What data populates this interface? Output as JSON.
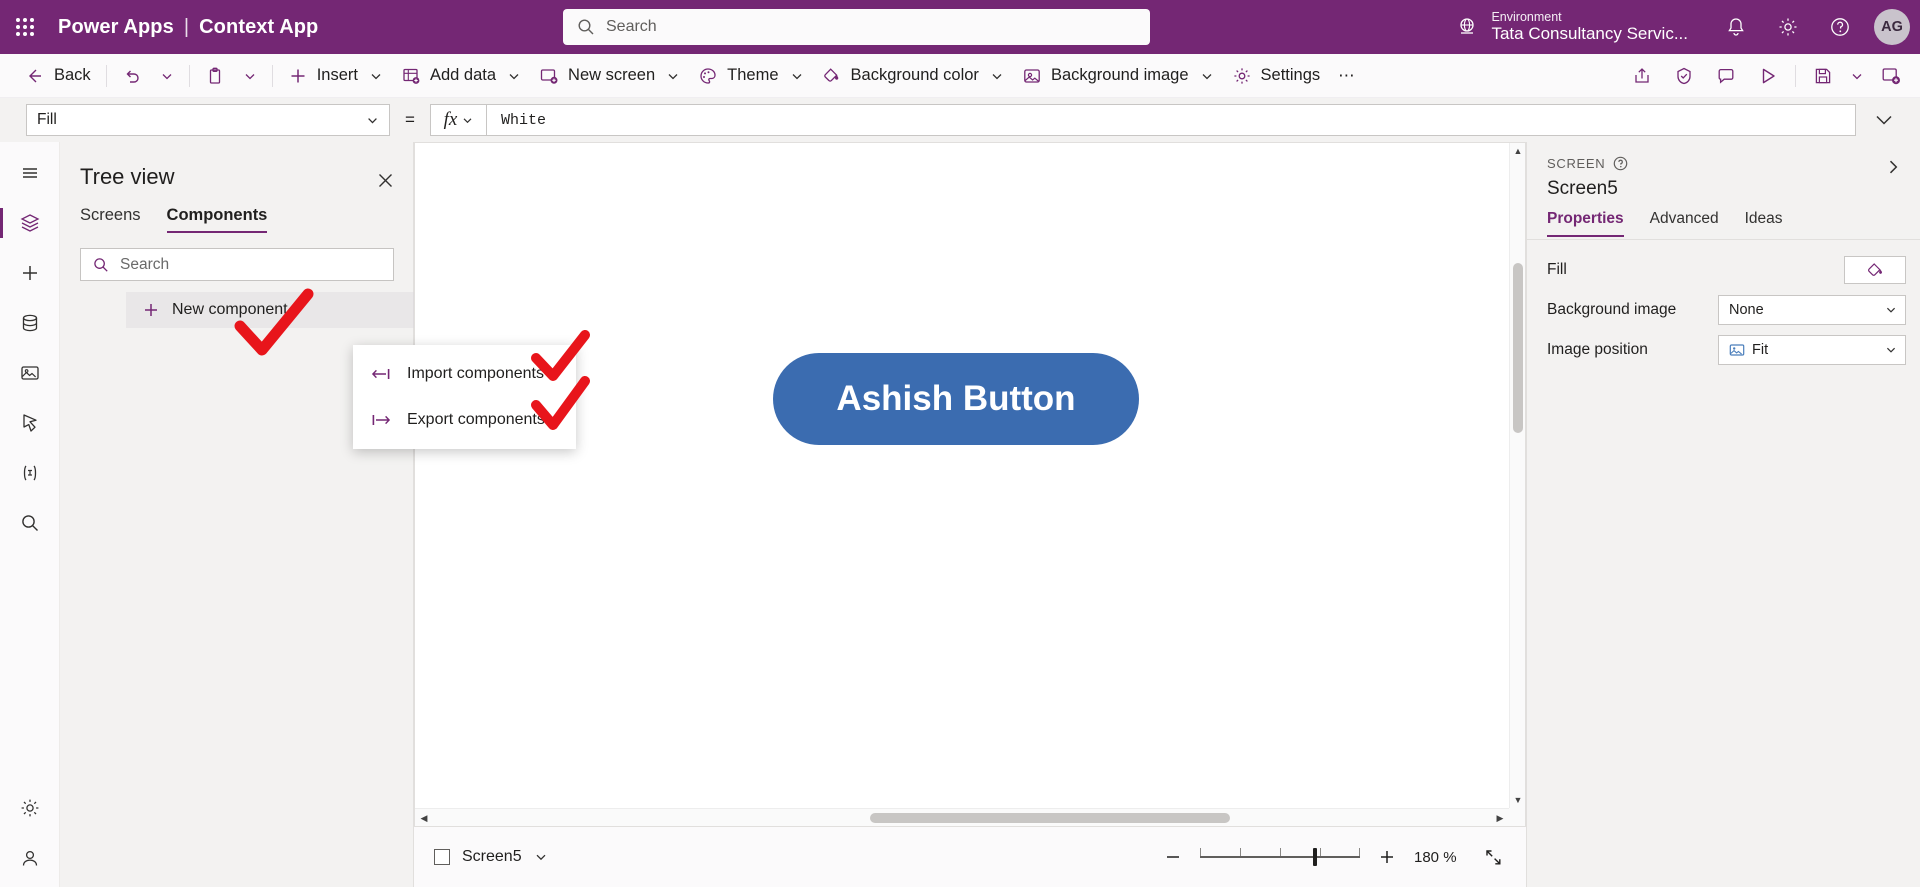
{
  "header": {
    "waffle_icon": "waffle-icon",
    "brand": "Power Apps",
    "separator": "|",
    "context_app": "Context App",
    "search_placeholder": "Search",
    "search_icon": "search-icon",
    "environment_label": "Environment",
    "environment_name": "Tata Consultancy Servic...",
    "environment_icon": "globe-icon",
    "notification_icon": "bell-icon",
    "settings_icon": "gear-icon",
    "help_icon": "help-icon",
    "avatar_initials": "AG",
    "accent_purple": "#742774"
  },
  "commandbar": {
    "back": "Back",
    "back_icon": "arrow-left-icon",
    "undo_icon": "undo-icon",
    "paste_icon": "clipboard-icon",
    "insert": "Insert",
    "insert_icon": "plus-icon",
    "add_data": "Add data",
    "add_data_icon": "database-grid-icon",
    "new_screen": "New screen",
    "new_screen_icon": "new-screen-icon",
    "theme": "Theme",
    "theme_icon": "palette-icon",
    "background_color": "Background color",
    "background_color_icon": "paint-bucket-icon",
    "background_image": "Background image",
    "background_image_icon": "image-icon",
    "settings": "Settings",
    "settings_icon": "gear-icon",
    "overflow": "⋯",
    "right_icons": [
      "share-icon",
      "checker-icon",
      "comment-icon",
      "play-icon",
      "save-icon",
      "chevron-down-icon",
      "publish-icon"
    ]
  },
  "formulabar": {
    "property": "Fill",
    "equals": "=",
    "fx_label": "fx",
    "value": "White",
    "expand_icon": "chevron-down-icon"
  },
  "rail": {
    "items": [
      {
        "name": "hamburger-icon"
      },
      {
        "name": "tree-view-icon"
      },
      {
        "name": "insert-icon"
      },
      {
        "name": "data-icon"
      },
      {
        "name": "media-icon"
      },
      {
        "name": "power-automate-icon"
      },
      {
        "name": "variables-icon"
      },
      {
        "name": "search-icon"
      }
    ],
    "bottom_items": [
      {
        "name": "settings-gear-icon"
      },
      {
        "name": "account-icon"
      }
    ]
  },
  "treeview": {
    "title": "Tree view",
    "close_icon": "close-icon",
    "tabs": [
      {
        "label": "Screens",
        "active": false
      },
      {
        "label": "Components",
        "active": true
      }
    ],
    "search_placeholder": "Search",
    "search_icon": "search-icon",
    "new_component": "New component",
    "new_component_icon": "plus-icon",
    "ellipsis_label": "•••"
  },
  "contextmenu": {
    "items": [
      {
        "label": "Import components",
        "icon": "import-arrow-icon"
      },
      {
        "label": "Export components",
        "icon": "export-arrow-icon"
      }
    ]
  },
  "annotations": {
    "marks": [
      "red-check-newcomponent",
      "red-check-import",
      "red-check-export"
    ],
    "color": "#e8151b"
  },
  "canvas": {
    "button_label": "Ashish Button",
    "button_color": "#3b6cb0",
    "scroll_up_icon": "caret-up-icon",
    "scroll_down_icon": "caret-down-icon",
    "scroll_left_icon": "caret-left-icon",
    "scroll_right_icon": "caret-right-icon"
  },
  "properties": {
    "kind": "SCREEN",
    "help_icon": "help-circle-icon",
    "expand_icon": "chevron-right-icon",
    "name": "Screen5",
    "tabs": [
      {
        "label": "Properties",
        "active": true
      },
      {
        "label": "Advanced",
        "active": false
      },
      {
        "label": "Ideas",
        "active": false
      }
    ],
    "rows": [
      {
        "label": "Fill",
        "control": "color",
        "value": "",
        "icon": "paint-bucket-icon"
      },
      {
        "label": "Background image",
        "control": "select",
        "value": "None",
        "icon": ""
      },
      {
        "label": "Image position",
        "control": "select",
        "value": "Fit",
        "icon": "image-icon"
      }
    ]
  },
  "statusbar": {
    "screen_name": "Screen5",
    "screen_chevron_icon": "chevron-down-icon",
    "zoom_out_icon": "minus-icon",
    "zoom_in_icon": "plus-icon",
    "zoom_value": "180 %",
    "fit_icon": "fit-screen-icon"
  }
}
